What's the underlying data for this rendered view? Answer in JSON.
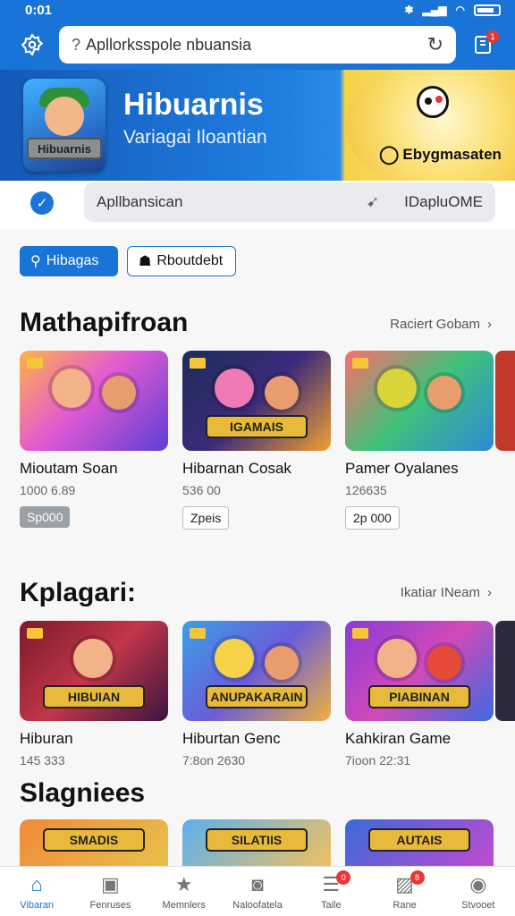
{
  "status_bar": {
    "time": "0:01"
  },
  "app_bar": {
    "search_text": "Apllorksspole nbuansia",
    "search_prefix": "?",
    "notification_count": "1"
  },
  "banner": {
    "title": "Hibuarnis",
    "subtitle": "Variagai Iloantian",
    "art_label": "Hibuarnis",
    "brand": "Ebygmasaten"
  },
  "secondary_search": {
    "text": "Apllbansican",
    "right_text": "IDapluOME"
  },
  "chips": [
    {
      "label": "Hibagas"
    },
    {
      "label": "Rboutdebt"
    }
  ],
  "sections": [
    {
      "title": "Mathapifroan",
      "see_all": "Raciert Gobam",
      "cards": [
        {
          "title": "Mioutam Soan",
          "meta": "1000 6.89",
          "price": "Sp000",
          "label": ""
        },
        {
          "title": "Hibarnan Cosak",
          "meta": "536 00",
          "price": "Zpeis",
          "label": "IGAMAIS"
        },
        {
          "title": "Pamer Oyalanes",
          "meta": "126635",
          "price": "2p 000",
          "label": ""
        }
      ]
    },
    {
      "title": "Kplagari:",
      "see_all": "Ikatiar INeam",
      "cards": [
        {
          "title": "Hiburan",
          "meta": "145 333",
          "label": "HIBUIAN"
        },
        {
          "title": "Hiburtan Genc",
          "meta": "7:8on 2630",
          "label": "ANUPAKARAIN"
        },
        {
          "title": "Kahkiran Game",
          "meta": "7ioon 22:31",
          "label": "PIABINAN"
        }
      ]
    },
    {
      "title": "Slagniees",
      "cards": [
        {
          "label": "SMADIS"
        },
        {
          "label": "SILATIIS"
        },
        {
          "label": "AUTAIS"
        }
      ]
    }
  ],
  "bottom_nav": [
    {
      "label": "Vibaran",
      "icon": "home-icon",
      "badge": ""
    },
    {
      "label": "Fenruses",
      "icon": "book-icon",
      "badge": ""
    },
    {
      "label": "Memnlers",
      "icon": "star-icon",
      "badge": ""
    },
    {
      "label": "Naloofatela",
      "icon": "bag-icon",
      "badge": ""
    },
    {
      "label": "Taile",
      "icon": "list-icon",
      "badge": "0"
    },
    {
      "label": "Rane",
      "icon": "image-icon",
      "badge": "8"
    },
    {
      "label": "Stvooet",
      "icon": "person-icon",
      "badge": ""
    }
  ],
  "colors": {
    "accent": "#1a73d6",
    "badge": "#e53935"
  }
}
